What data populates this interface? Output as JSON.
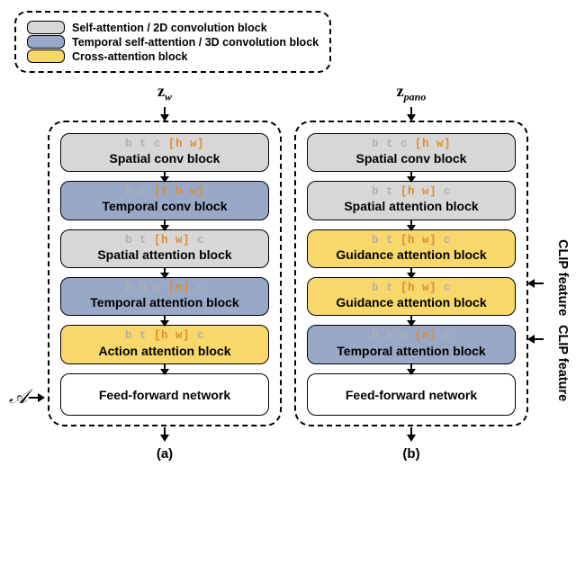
{
  "legend": {
    "items": [
      {
        "label": "Self-attention / 2D convolution block",
        "color": "grey"
      },
      {
        "label": "Temporal self-attention / 3D convolution block",
        "color": "blue"
      },
      {
        "label": "Cross-attention block",
        "color": "yellow"
      }
    ]
  },
  "columns": {
    "a": {
      "input": "z",
      "input_sub": "w",
      "blocks": [
        {
          "dims_pre": "b t c ",
          "dims_hl": "[h w]",
          "dims_post": "",
          "title": "Spatial conv block",
          "fill": "grey"
        },
        {
          "dims_pre": "b c ",
          "dims_hl": "[t h w]",
          "dims_post": "",
          "title": "Temporal conv block",
          "fill": "blue"
        },
        {
          "dims_pre": "b t ",
          "dims_hl": "[h w]",
          "dims_post": " c",
          "title": "Spatial attention block",
          "fill": "grey"
        },
        {
          "dims_pre": "b h w ",
          "dims_hl": "[n]",
          "dims_post": " c",
          "title": "Temporal attention block",
          "fill": "blue"
        },
        {
          "dims_pre": "b t ",
          "dims_hl": "[h w]",
          "dims_post": " c",
          "title": "Action attention block",
          "fill": "yellow"
        },
        {
          "dims_pre": "",
          "dims_hl": "",
          "dims_post": "",
          "title": "Feed-forward network",
          "fill": "white"
        }
      ],
      "label": "(a)",
      "side_input": "𝒜"
    },
    "b": {
      "input": "z",
      "input_sub": "pano",
      "blocks": [
        {
          "dims_pre": "b t c ",
          "dims_hl": "[h w]",
          "dims_post": "",
          "title": "Spatial conv block",
          "fill": "grey"
        },
        {
          "dims_pre": "b t ",
          "dims_hl": "[h w]",
          "dims_post": " c",
          "title": "Spatial attention block",
          "fill": "grey"
        },
        {
          "dims_pre": "b t ",
          "dims_hl": "[h w]",
          "dims_post": " c",
          "title": "Guidance attention block",
          "fill": "yellow"
        },
        {
          "dims_pre": "b t ",
          "dims_hl": "[h w]",
          "dims_post": " c",
          "title": "Guidance attention block",
          "fill": "yellow"
        },
        {
          "dims_pre": "b h w ",
          "dims_hl": "[n]",
          "dims_post": " c",
          "title": "Temporal attention block",
          "fill": "blue"
        },
        {
          "dims_pre": "",
          "dims_hl": "",
          "dims_post": "",
          "title": "Feed-forward network",
          "fill": "white"
        }
      ],
      "label": "(b)",
      "side_inputs": {
        "clip1": "CLIP feature",
        "clip2": "CLIP feature"
      }
    }
  }
}
